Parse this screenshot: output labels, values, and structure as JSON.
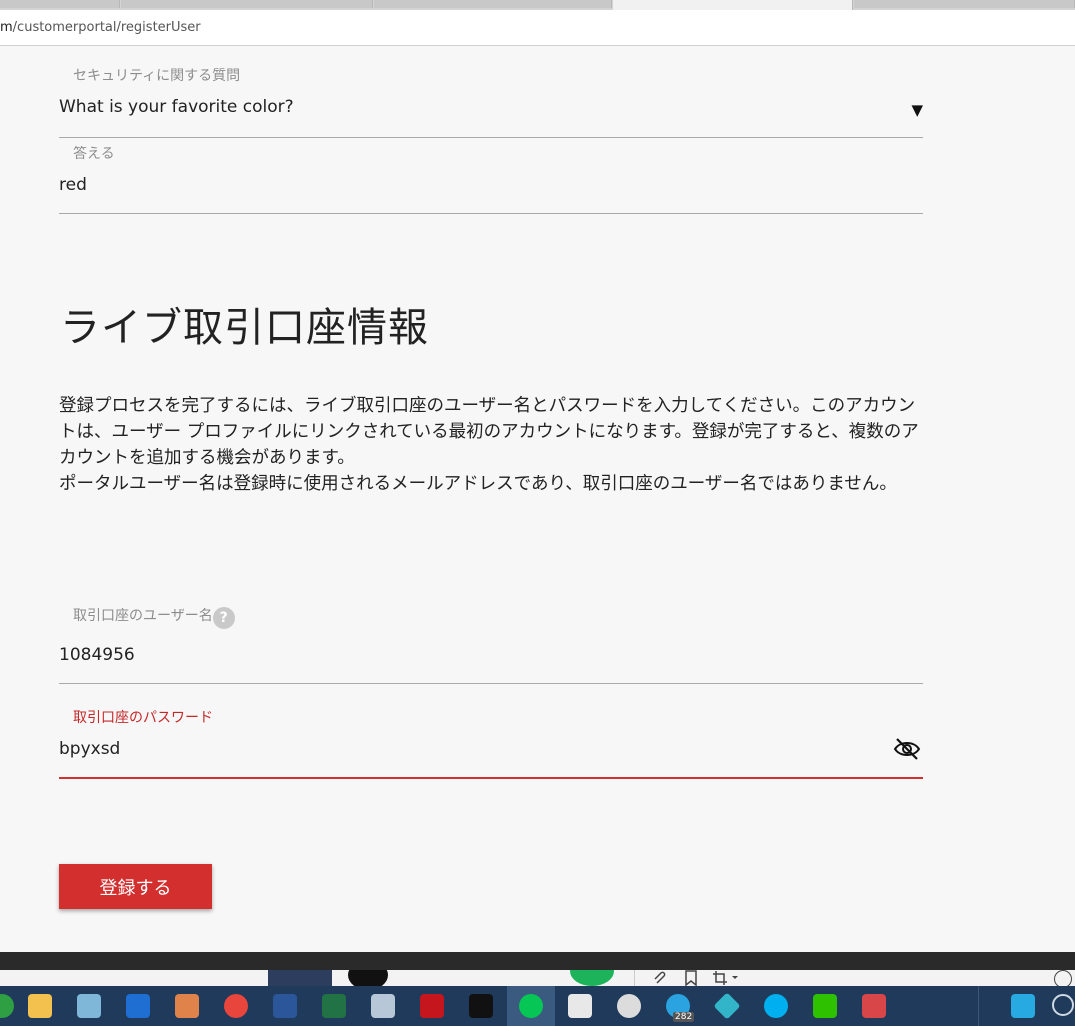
{
  "browser": {
    "url_host_fragment": "m",
    "url_path": "/customerportal/registerUser"
  },
  "security": {
    "question_label": "セキュリティに関する質問",
    "question_value": "What is your favorite color?",
    "answer_label": "答える",
    "answer_value": "red"
  },
  "live_account": {
    "heading": "ライブ取引口座情報",
    "paragraph_1": "登録プロセスを完了するには、ライブ取引口座のユーザー名とパスワードを入力してください。このアカウントは、ユーザー プロファイルにリンクされている最初のアカウントになります。登録が完了すると、複数のアカウントを追加する機会があります。",
    "paragraph_2": "ポータルユーザー名は登録時に使用されるメールアドレスであり、取引口座のユーザー名ではありません。",
    "username_label": "取引口座のユーザー名",
    "username_help": "?",
    "username_value": "1084956",
    "password_label": "取引口座のパスワード",
    "password_value": "bpyxsd"
  },
  "actions": {
    "submit_label": "登録する"
  },
  "taskbar": {
    "telegram_badge": "282"
  },
  "colors": {
    "accent_red": "#d32f2f",
    "error_label": "#c62828",
    "background": "#f7f7f7"
  }
}
